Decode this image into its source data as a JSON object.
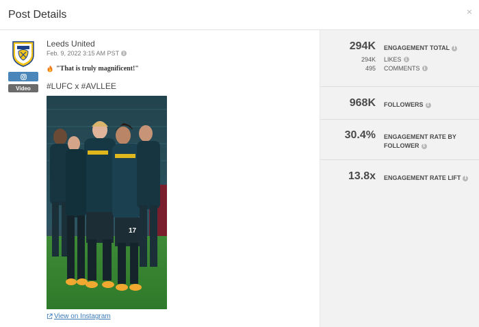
{
  "header": {
    "title": "Post Details",
    "close": "×"
  },
  "post": {
    "account": "Leeds United",
    "date": "Feb. 9, 2022 3:15 AM PST",
    "caption": "\"That is truly magnificent!\"",
    "hashtags": "#LUFC x #AVLLEE",
    "media_type": "Video",
    "platform_icon": "instagram-icon",
    "view_link": "View on Instagram"
  },
  "metrics": {
    "engagement_total": {
      "value": "294K",
      "label": "ENGAGEMENT TOTAL"
    },
    "likes": {
      "value": "294K",
      "label": "LIKES"
    },
    "comments": {
      "value": "495",
      "label": "COMMENTS"
    },
    "followers": {
      "value": "968K",
      "label": "FOLLOWERS"
    },
    "engagement_rate": {
      "value": "30.4%",
      "label_line1": "ENGAGEMENT RATE BY",
      "label_line2": "FOLLOWER"
    },
    "engagement_rate_lift": {
      "value": "13.8x",
      "label": "ENGAGEMENT RATE LIFT"
    }
  },
  "colors": {
    "instagram_badge": "#4a86b9",
    "video_badge": "#6b6b6b",
    "link": "#3a7ab8",
    "panel_bg": "#f2f2f2"
  }
}
